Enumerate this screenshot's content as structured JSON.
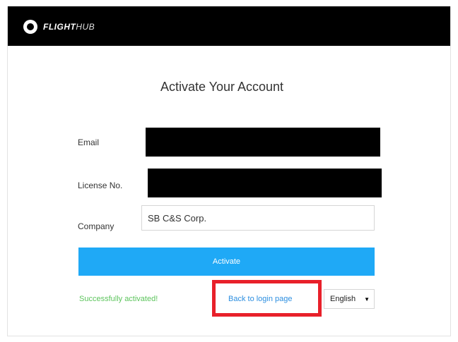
{
  "header": {
    "logo_bold": "FLIGHT",
    "logo_light": "HUB"
  },
  "form": {
    "title": "Activate Your Account",
    "email_label": "Email",
    "license_label": "License No.",
    "company_label": "Company",
    "company_value": "SB C&S Corp.",
    "activate_label": "Activate"
  },
  "footer": {
    "success_message": "Successfully activated!",
    "back_link": "Back to login page",
    "language_selected": "English"
  },
  "colors": {
    "topbar": "#000000",
    "activate_button": "#1fa9f6",
    "success_text": "#5cc45c",
    "link_text": "#2d8fe0",
    "highlight_border": "#e8202a"
  },
  "redactions": [
    "email-value",
    "license-value"
  ],
  "icons": {
    "logo": "flighthub-logo-icon",
    "dropdown": "caret-down-icon"
  }
}
